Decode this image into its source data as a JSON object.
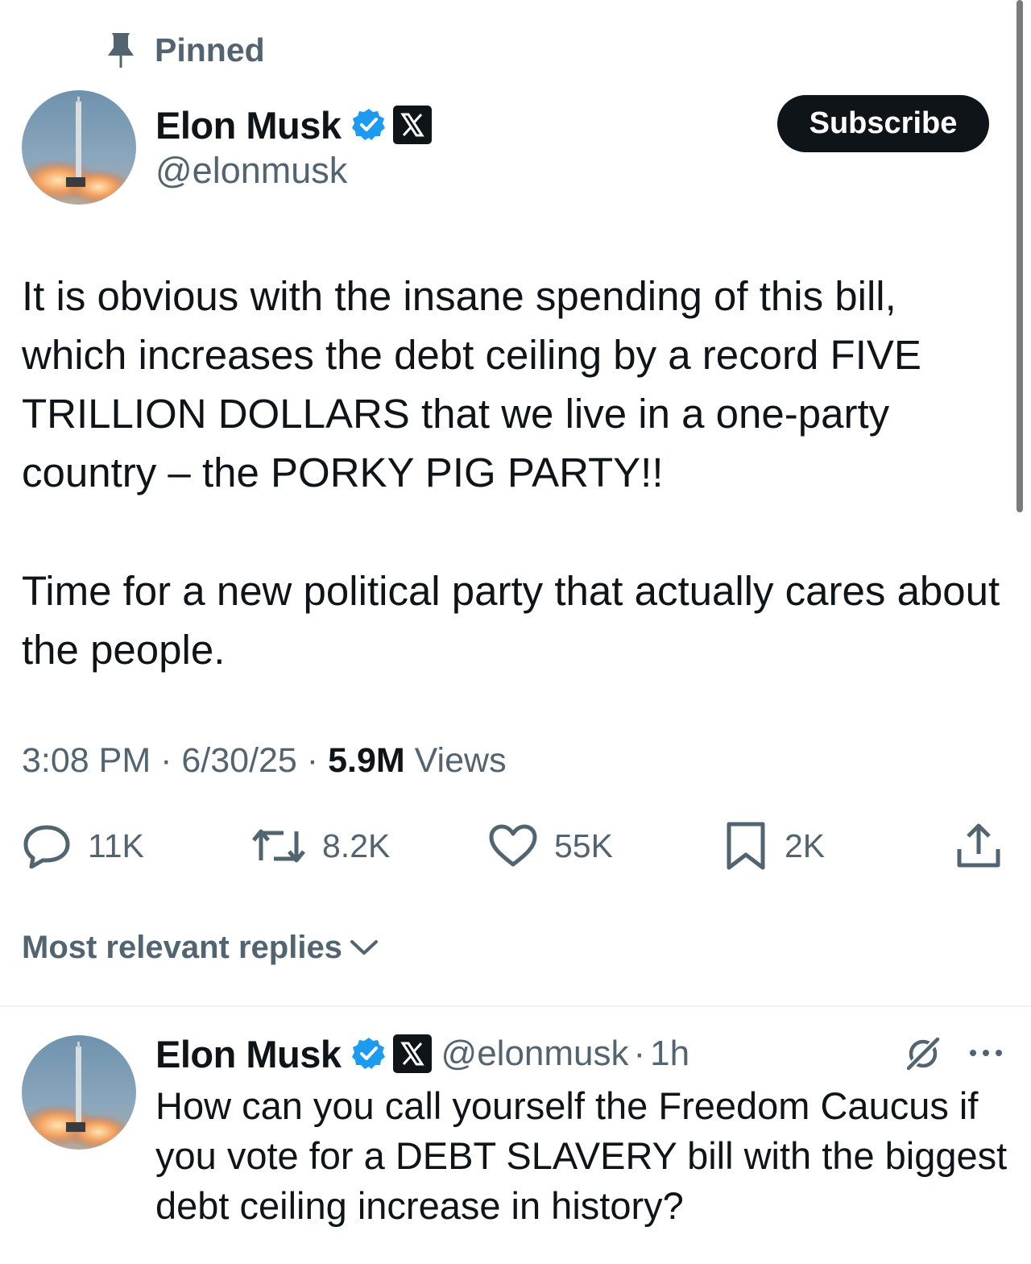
{
  "pinned": {
    "label": "Pinned",
    "icon": "pin-icon"
  },
  "tweet": {
    "author": {
      "name": "Elon Musk",
      "handle": "@elonmusk",
      "verified": true,
      "affiliate_badge": "x-logo-icon"
    },
    "subscribe_label": "Subscribe",
    "text_paragraphs": [
      "It is obvious with the insane spending of this bill, which increases the debt ceiling by a record FIVE TRILLION DOLLARS that we live in a one-party country – the PORKY PIG PARTY!!",
      "Time for a new political party that actually cares about the people."
    ],
    "time": "3:08 PM",
    "date": "6/30/25",
    "separator": "·",
    "views_count": "5.9M",
    "views_label": "Views",
    "stats": {
      "replies": "11K",
      "retweets": "8.2K",
      "likes": "55K",
      "bookmarks": "2K"
    }
  },
  "replies_sort": {
    "label": "Most relevant replies"
  },
  "reply": {
    "author": {
      "name": "Elon Musk",
      "handle": "@elonmusk",
      "verified": true
    },
    "time": "1h",
    "separator": "·",
    "text": "How can you call yourself the Freedom Caucus if you vote for a DEBT SLAVERY bill with the biggest debt ceiling increase in history?"
  },
  "colors": {
    "text_primary": "#0f1419",
    "text_secondary": "#536471",
    "verified_blue": "#1d9bf0",
    "button_dark": "#0f1419",
    "divider": "#eff3f4"
  }
}
